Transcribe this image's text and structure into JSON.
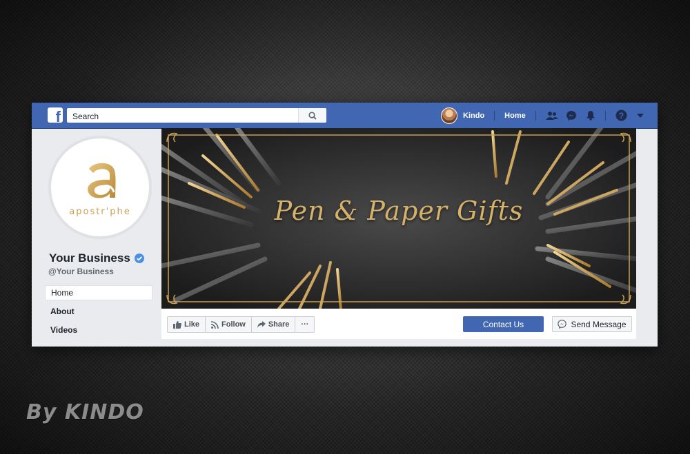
{
  "topbar": {
    "logo_icon": "facebook-f-icon",
    "search_placeholder": "Search",
    "user_name": "Kindo",
    "home_label": "Home",
    "icons": [
      "friends-icon",
      "messenger-icon",
      "bell-icon",
      "help-icon",
      "caret-down-icon"
    ]
  },
  "profile": {
    "logo_text": "apostr'phe",
    "business_name": "Your Business",
    "handle": "@Your Business",
    "nav": [
      {
        "label": "Home",
        "active": true
      },
      {
        "label": "About",
        "active": false
      },
      {
        "label": "Videos",
        "active": false
      }
    ]
  },
  "cover": {
    "title": "Pen & Paper Gifts"
  },
  "actions": {
    "like": "Like",
    "follow": "Follow",
    "share": "Share",
    "more": "···",
    "contact": "Contact Us",
    "send_message": "Send Message"
  },
  "watermark": "By KINDO",
  "colors": {
    "fb_blue": "#4267b2",
    "gold": "#d6b16a",
    "cover_dark": "#2b2b2b"
  }
}
